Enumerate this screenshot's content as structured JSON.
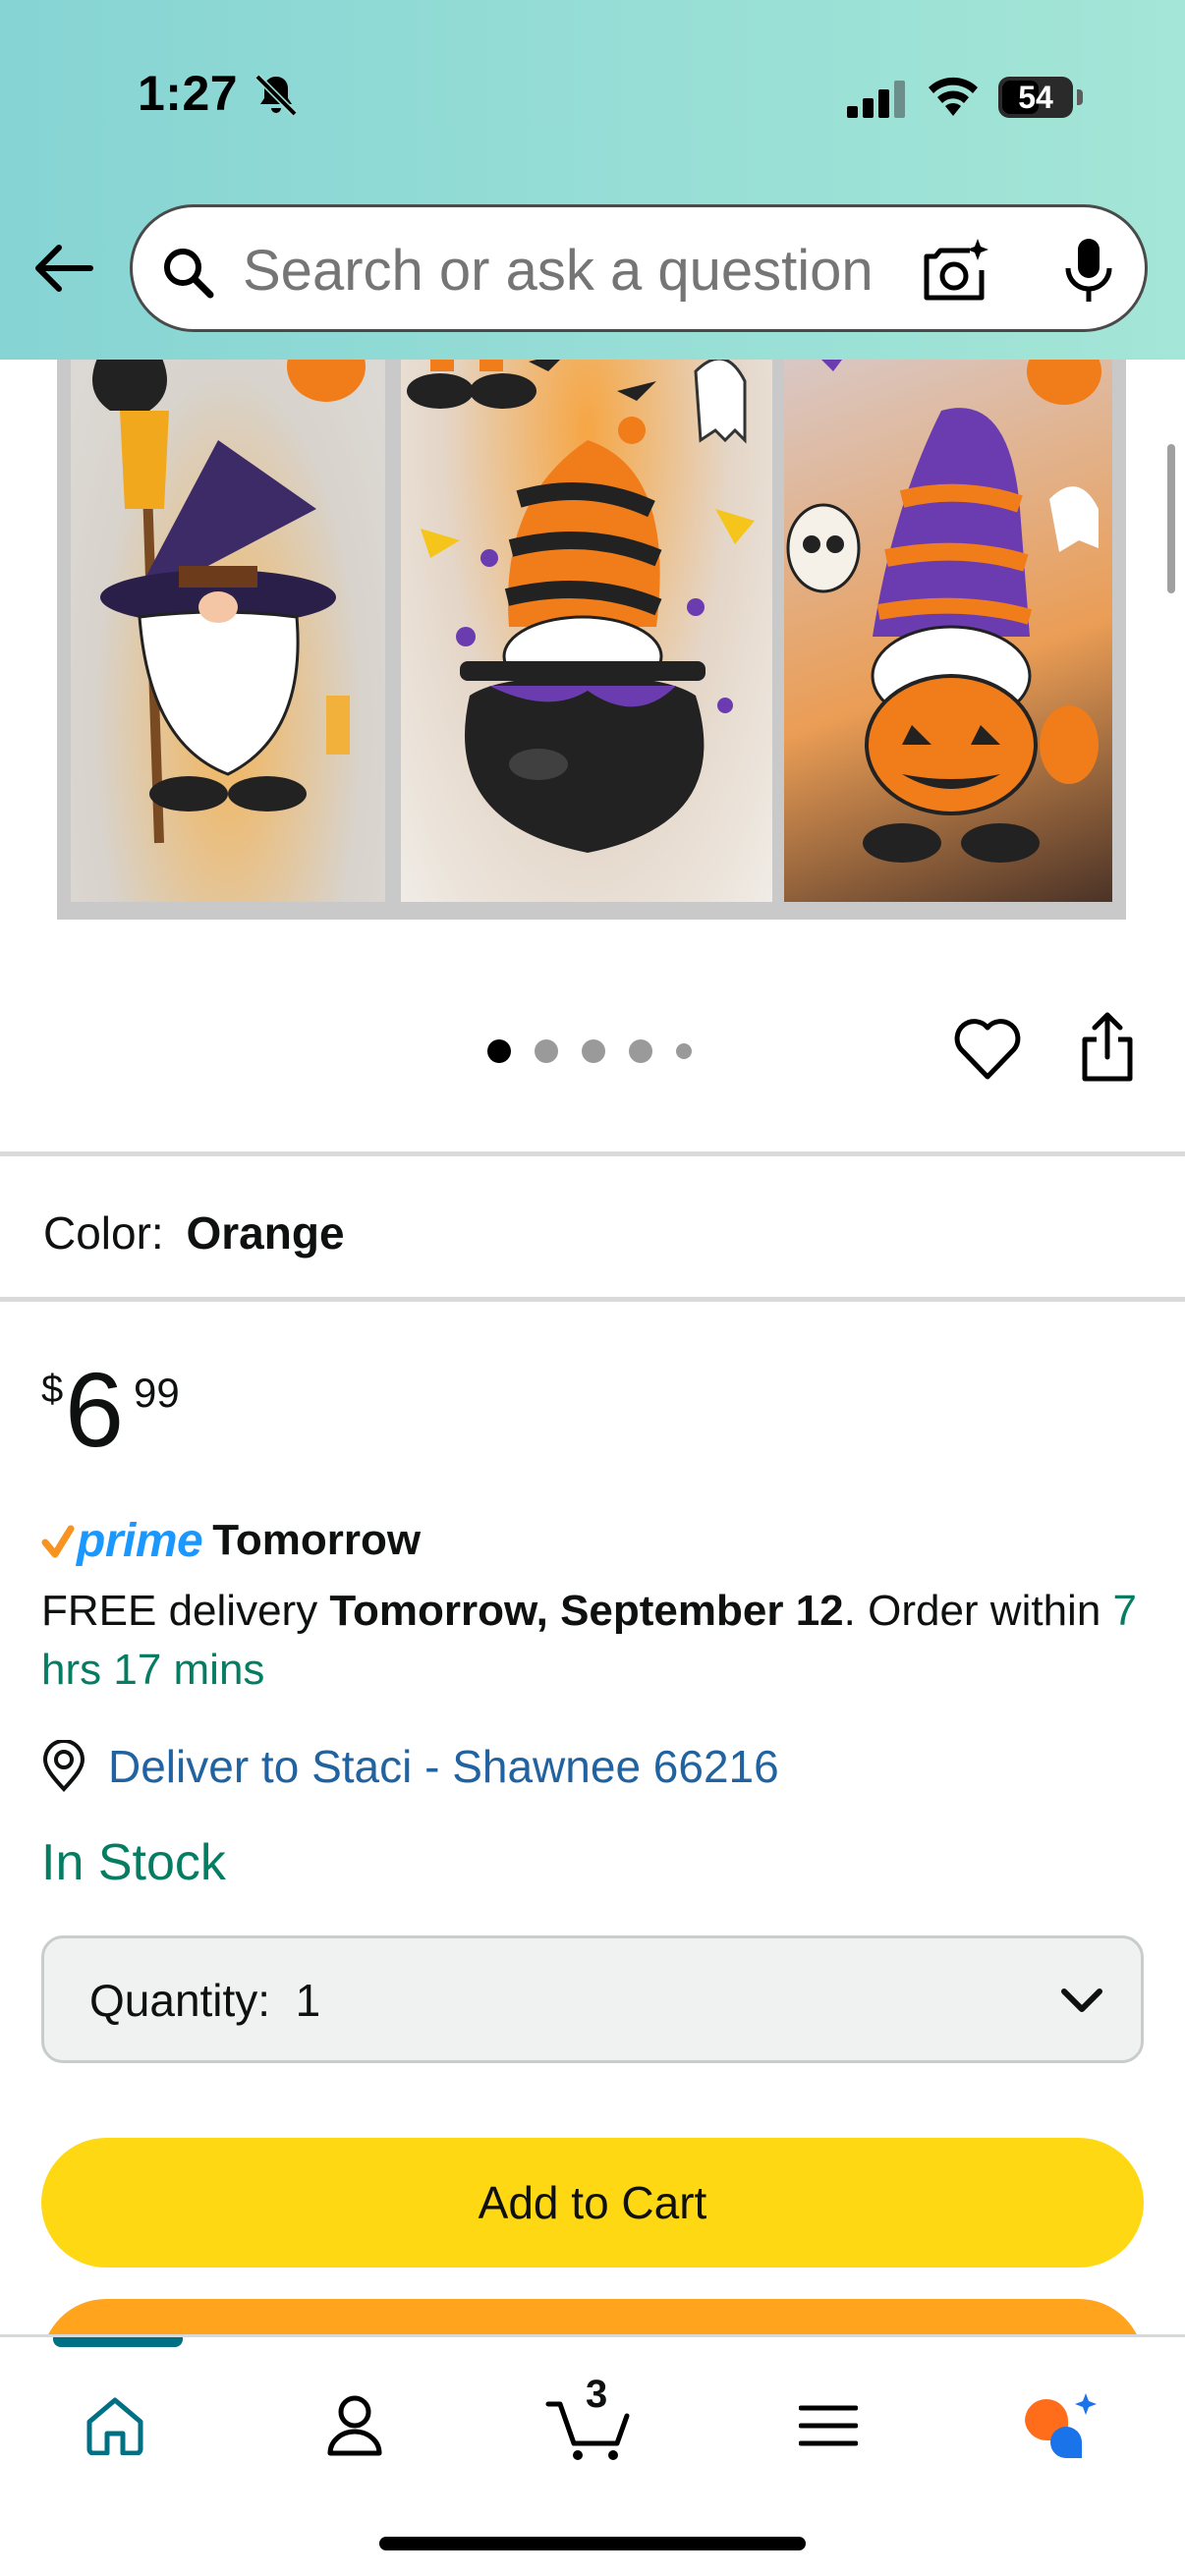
{
  "status_bar": {
    "time": "1:27",
    "battery": "54",
    "battery_level": 0.54
  },
  "search": {
    "placeholder": "Search or ask a question"
  },
  "carousel": {
    "total_images": 5,
    "active_index": 0
  },
  "color": {
    "label": "Color:",
    "value": "Orange"
  },
  "price": {
    "currency": "$",
    "whole": "6",
    "fraction": "99"
  },
  "delivery": {
    "prime_label": "prime",
    "prime_day": "Tomorrow",
    "free_prefix": "FREE delivery ",
    "date": "Tomorrow, September 12",
    "order_within": ". Order within ",
    "countdown": "7 hrs 17 mins",
    "location": "Deliver to Staci - Shawnee 66216"
  },
  "stock": "In Stock",
  "quantity": {
    "label": "Quantity:",
    "value": "1"
  },
  "buttons": {
    "add_to_cart": "Add to Cart"
  },
  "nav": {
    "cart_count": "3",
    "items": [
      "home-icon",
      "account-icon",
      "cart-icon",
      "menu-icon",
      "rufus-icon"
    ]
  },
  "colors": {
    "accent_teal": "#007185",
    "in_stock_green": "#067d62",
    "link_blue": "#2162a1",
    "add_to_cart_yellow": "#ffd814",
    "buy_now_orange": "#ffa41c",
    "prime_blue": "#1a98ff"
  }
}
